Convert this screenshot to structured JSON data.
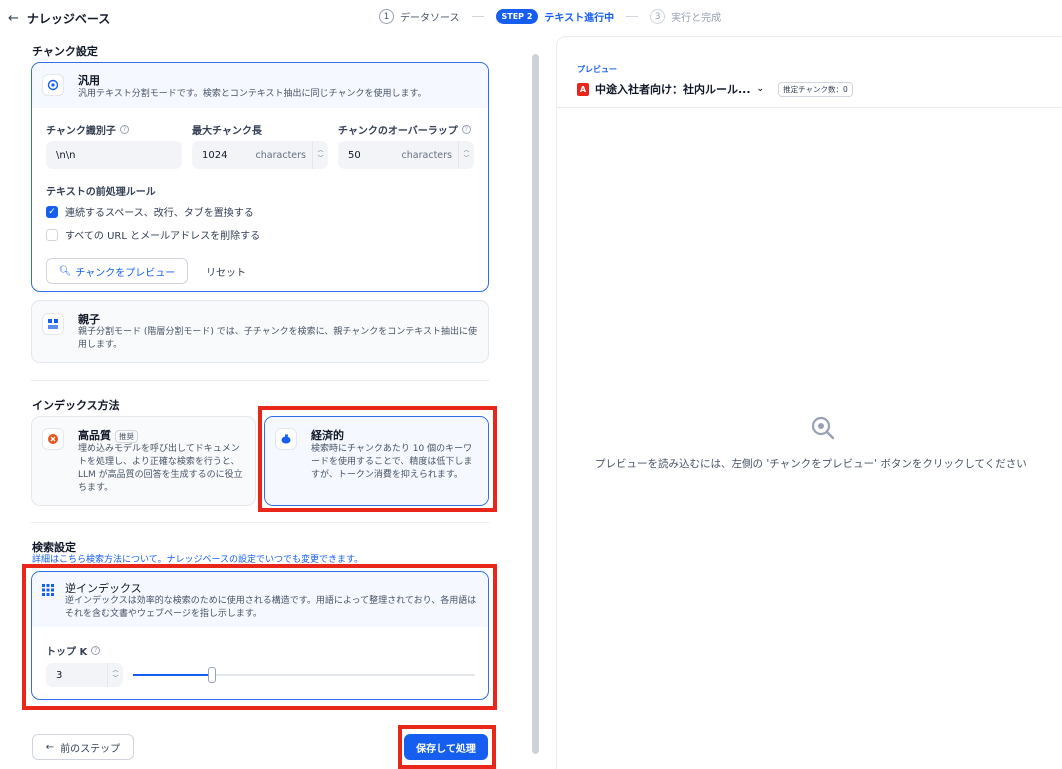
{
  "header": {
    "back_label": "ナレッジベース",
    "steps": [
      {
        "num": "1",
        "label": "データソース"
      },
      {
        "pill": "STEP 2",
        "label": "テキスト進行中"
      },
      {
        "num": "3",
        "label": "実行と完成"
      }
    ]
  },
  "chunk_settings": {
    "title": "チャンク設定",
    "general": {
      "name": "汎用",
      "desc": "汎用テキスト分割モードです。検索とコンテキスト抽出に同じチャンクを使用します。",
      "delimiter_label": "チャンク識別子",
      "delimiter_value": "\\n\\n",
      "max_len_label": "最大チャンク長",
      "max_len_value": "1024",
      "overlap_label": "チャンクのオーバーラップ",
      "overlap_value": "50",
      "unit": "characters",
      "rules_label": "テキストの前処理ルール",
      "rule1": "連続するスペース、改行、タブを置換する",
      "rule1_checked": true,
      "rule2": "すべての URL とメールアドレスを削除する",
      "rule2_checked": false,
      "preview_button": "チャンクをプレビュー",
      "reset_button": "リセット"
    },
    "parent": {
      "name": "親子",
      "desc": "親子分割モード (階層分割モード) では、子チャンクを検索に、親チャンクをコンテキスト抽出に使用します。"
    }
  },
  "index_method": {
    "title": "インデックス方法",
    "high_quality": {
      "name": "高品質",
      "badge": "推奨",
      "desc": "埋め込みモデルを呼び出してドキュメントを処理し、より正確な検索を行うと、LLM が高品質の回答を生成するのに役立ちます。"
    },
    "economic": {
      "name": "経済的",
      "desc": "検索時にチャンクあたり 10 個のキーワードを使用することで、精度は低下しますが、トークン消費を抑えられます。"
    }
  },
  "retrieval": {
    "title": "検索設定",
    "note": "詳細はこちら検索方法について。ナレッジベースの設定でいつでも変更できます。",
    "inverted": {
      "name": "逆インデックス",
      "desc": "逆インデックスは効率的な検索のために使用される構造です。用語によって整理されており、各用語はそれを含む文書やウェブページを指し示します。"
    },
    "topk_label": "トップ K",
    "topk_value": "3",
    "topk_fraction": 0.23
  },
  "footer": {
    "prev_button": "前のステップ",
    "save_button": "保存して処理"
  },
  "preview": {
    "caption": "プレビュー",
    "doc_title": "中途入社者向け：社内ルール...",
    "chip": "推定チャンク数：0",
    "empty_text": "プレビューを読み込むには、左側の 'チャンクをプレビュー' ボタンをクリックしてください"
  },
  "colors": {
    "accent": "#155eef",
    "highlight": "#e8261a"
  }
}
